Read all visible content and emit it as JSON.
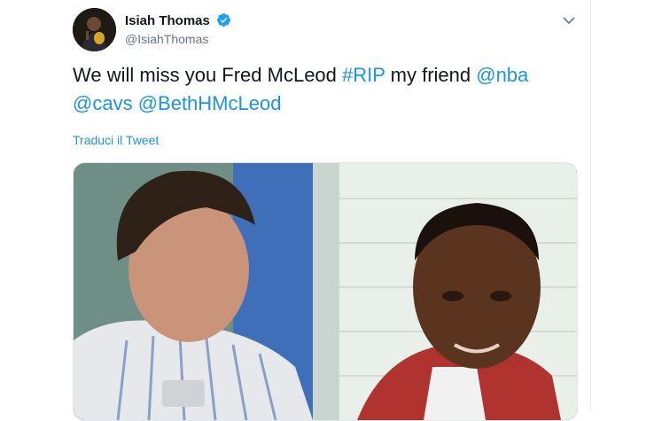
{
  "tweet": {
    "author": {
      "name": "Isiah Thomas",
      "handle": "@IsiahThomas",
      "verified": true
    },
    "text": {
      "part1": "We will miss you Fred McLeod ",
      "hashtag": "#RIP",
      "part2": " my friend ",
      "mention1": "@nba",
      "mention2": "@cavs",
      "mention3": "@BethHMcLeod"
    },
    "translate_label": "Traduci il Tweet"
  },
  "icons": {
    "verified": "verified-badge-icon",
    "caret": "chevron-down-icon"
  },
  "colors": {
    "link": "#1b95e0",
    "text": "#14171a",
    "secondary": "#657786"
  }
}
